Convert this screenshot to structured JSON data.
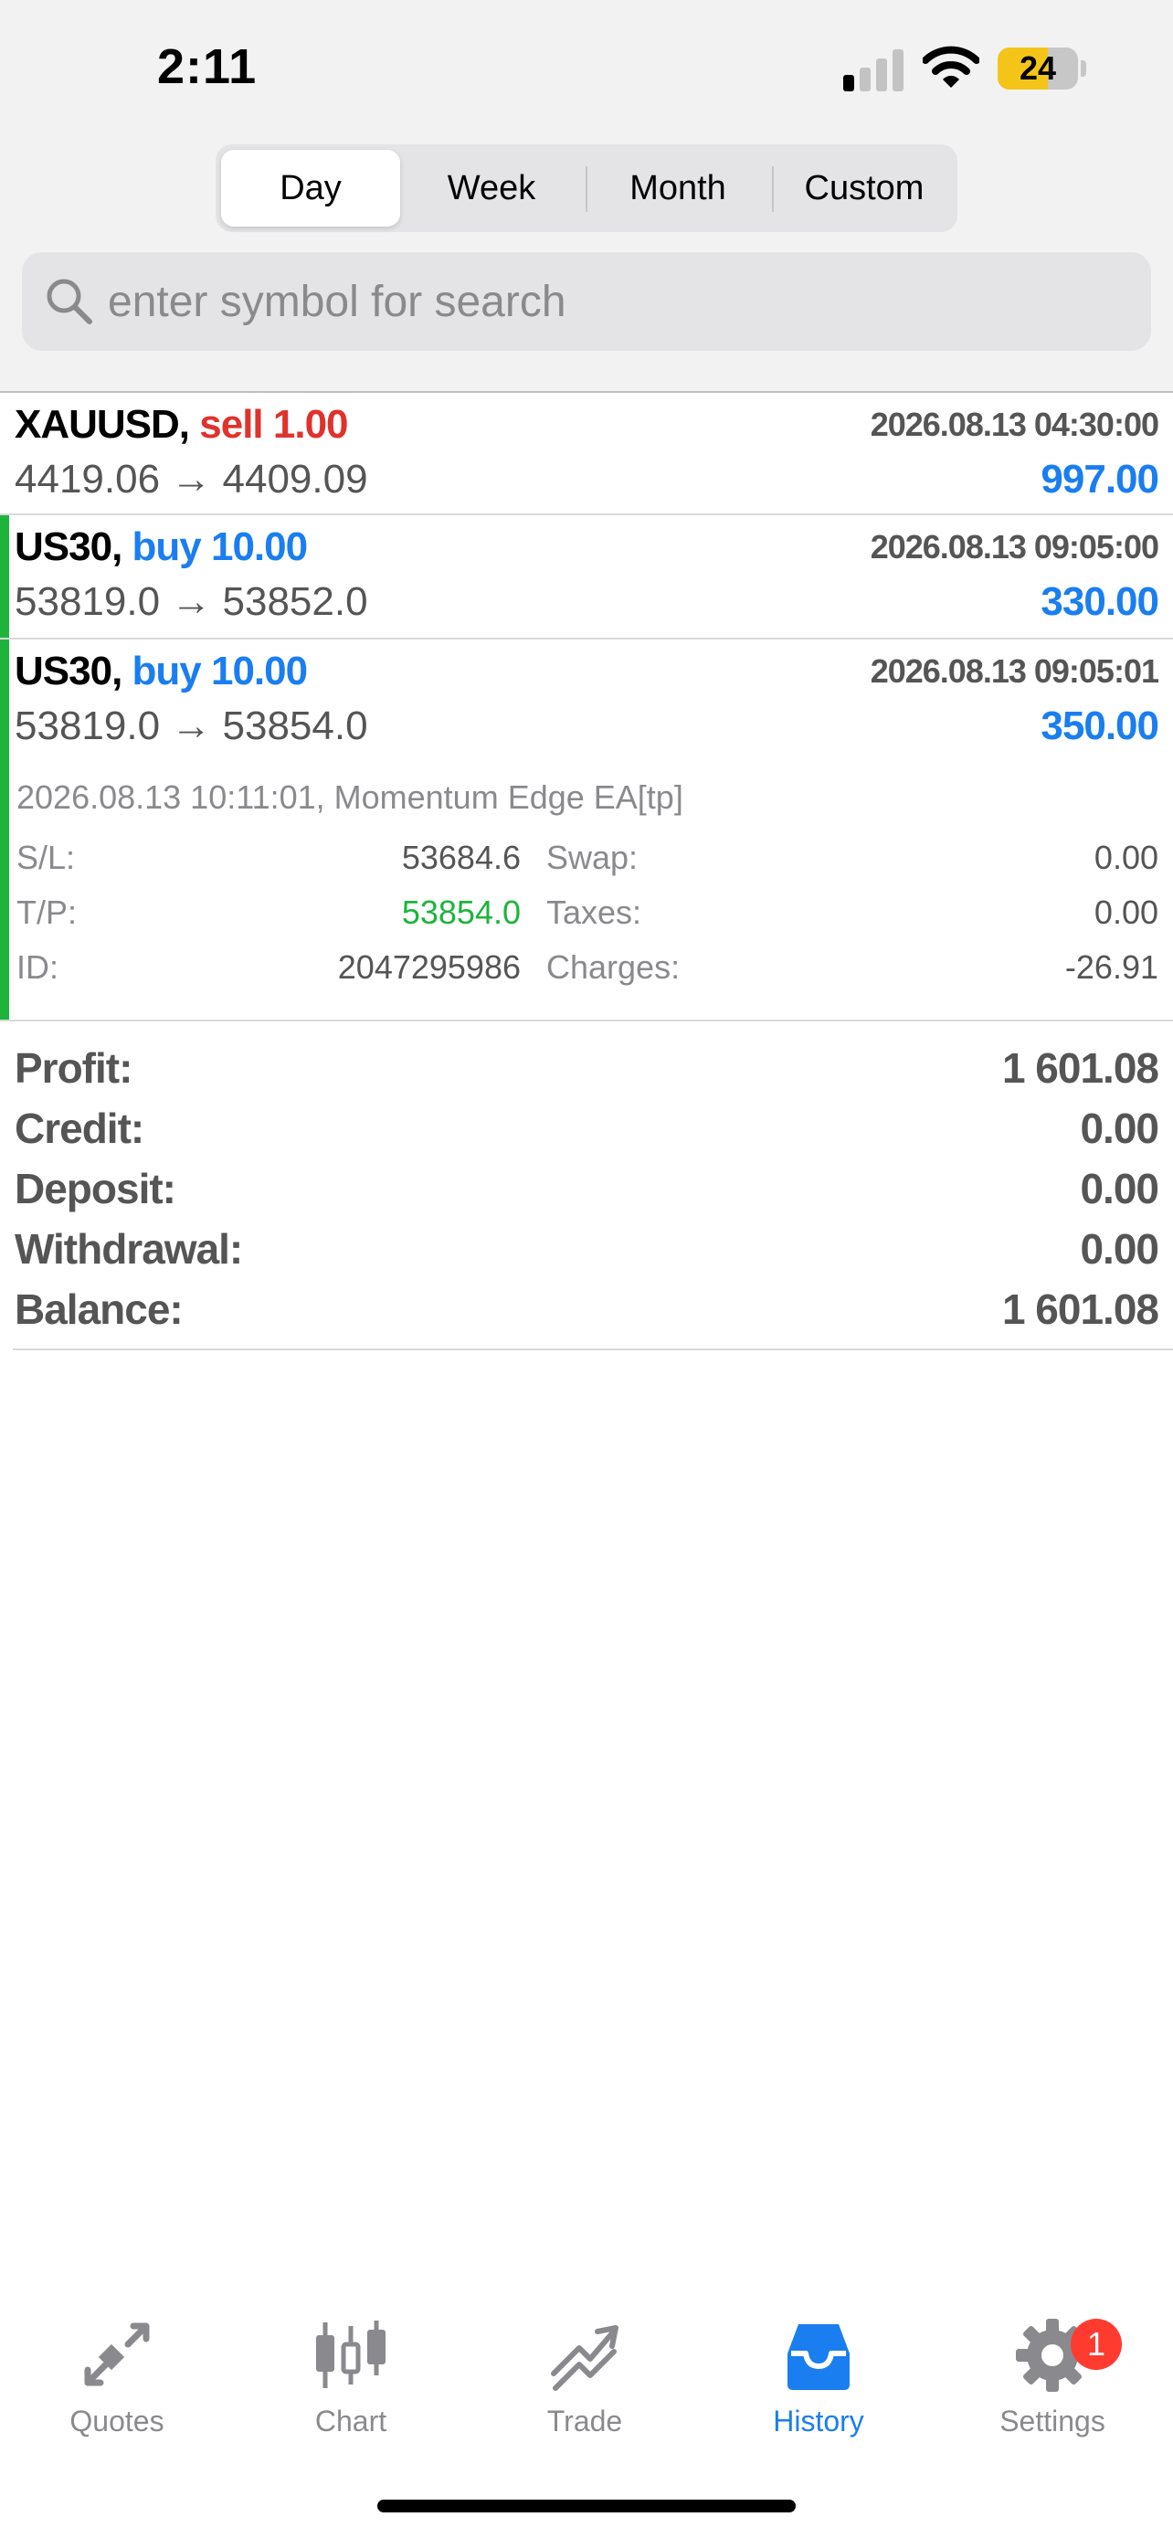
{
  "status_bar": {
    "time": "2:11",
    "battery": "24",
    "battery_level": 0.24,
    "signal_bars_active": 1,
    "signal_bars_total": 4
  },
  "period_tabs": [
    "Day",
    "Week",
    "Month",
    "Custom"
  ],
  "selected_period": "Day",
  "search": {
    "placeholder": "enter symbol for search",
    "value": ""
  },
  "deals": [
    {
      "symbol": "XAUUSD,",
      "action": "sell 1.00",
      "type": "sell",
      "time": "2026.08.13 04:30:00",
      "prices": "4419.06 → 4409.09",
      "profit": "997.00"
    },
    {
      "symbol": "US30,",
      "action": "buy 10.00",
      "type": "buy",
      "time": "2026.08.13 09:05:00",
      "prices": "53819.0 → 53852.0",
      "profit": "330.00"
    },
    {
      "symbol": "US30,",
      "action": "buy 10.00",
      "type": "buy",
      "time": "2026.08.13 09:05:01",
      "prices": "53819.0 → 53854.0",
      "profit": "350.00",
      "details": {
        "comment": "2026.08.13 10:11:01, Momentum Edge EA[tp]",
        "sl_label": "S/L:",
        "sl": "53684.6",
        "tp_label": "T/P:",
        "tp": "53854.0",
        "id_label": "ID:",
        "id": "2047295986",
        "swap_label": "Swap:",
        "swap": "0.00",
        "taxes_label": "Taxes:",
        "taxes": "0.00",
        "charges_label": "Charges:",
        "charges": "-26.91"
      }
    }
  ],
  "summary": [
    {
      "label": "Profit:",
      "value": "1 601.08"
    },
    {
      "label": "Credit:",
      "value": "0.00"
    },
    {
      "label": "Deposit:",
      "value": "0.00"
    },
    {
      "label": "Withdrawal:",
      "value": "0.00"
    },
    {
      "label": "Balance:",
      "value": "1 601.08"
    }
  ],
  "tab_bar": {
    "items": [
      {
        "label": "Quotes",
        "icon": "quotes-icon"
      },
      {
        "label": "Chart",
        "icon": "chart-icon"
      },
      {
        "label": "Trade",
        "icon": "trade-icon"
      },
      {
        "label": "History",
        "icon": "history-icon"
      },
      {
        "label": "Settings",
        "icon": "gear-icon"
      }
    ],
    "active": "History",
    "settings_badge": "1"
  },
  "colors": {
    "accent": "#1a7ef0",
    "sell": "#e0322c",
    "positive": "#1eb43c",
    "badge": "#ff3b30"
  }
}
